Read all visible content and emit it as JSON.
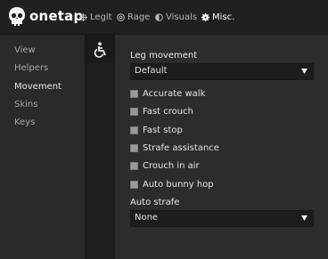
{
  "brand": "onetap",
  "nav": [
    {
      "label": "Legit",
      "icon": "crosshair-icon"
    },
    {
      "label": "Rage",
      "icon": "target-icon"
    },
    {
      "label": "Visuals",
      "icon": "half-circle-icon"
    },
    {
      "label": "Misc.",
      "icon": "gear-icon"
    }
  ],
  "sidebar": {
    "items": [
      {
        "label": "View"
      },
      {
        "label": "Helpers"
      },
      {
        "label": "Movement"
      },
      {
        "label": "Skins"
      },
      {
        "label": "Keys"
      }
    ]
  },
  "strip_icon": "accessibility-icon",
  "movement": {
    "leg_movement_label": "Leg movement",
    "leg_movement_value": "Default",
    "checkboxes": [
      {
        "label": "Accurate walk"
      },
      {
        "label": "Fast crouch"
      },
      {
        "label": "Fast stop"
      },
      {
        "label": "Strafe assistance"
      },
      {
        "label": "Crouch in air"
      },
      {
        "label": "Auto bunny hop"
      }
    ],
    "auto_strafe_label": "Auto strafe",
    "auto_strafe_value": "None"
  },
  "colors": {
    "topbar": "#202020",
    "sidebar": "#2a2a2a",
    "strip": "#1e1e1e",
    "content": "#2c2c2c",
    "dropdown": "#1d1d1d"
  }
}
